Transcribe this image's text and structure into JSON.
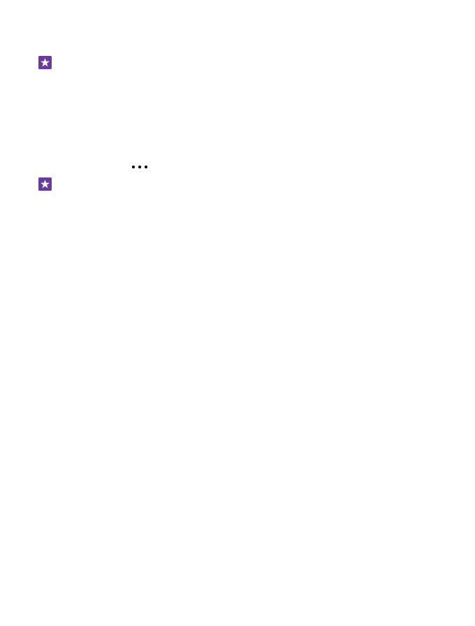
{
  "colors": {
    "tip_icon_background": "#6B3B9A",
    "tip_icon_foreground": "#FFFFFF",
    "more_glyph": "#000000",
    "page_background": "#FFFFFF"
  },
  "icons": {
    "tip_icon": "star-in-square-icon",
    "more_glyph": "more-dots-icon"
  }
}
